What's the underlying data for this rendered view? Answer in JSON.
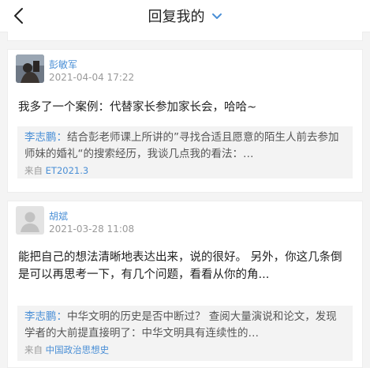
{
  "header": {
    "title": "回复我的",
    "back_icon": "back-arrow-icon",
    "dropdown_icon": "chevron-down-icon"
  },
  "colors": {
    "accent": "#4a8fd6",
    "background": "#f4f4f4"
  },
  "replies": [
    {
      "author": "彭敏军",
      "time": "2021-04-04 17:22",
      "content": "我多了一个案例：代替家长参加家长会，哈哈~",
      "quote_author": "李志鹏：",
      "quote_text": "结合彭老师课上所讲的”寻找合适且愿意的陌生人前去参加师妹的婚礼“的搜索经历，我谈几点我的看法：…",
      "source_prefix": "来自",
      "source_link": "ET2021.3"
    },
    {
      "author": "胡斌",
      "time": "2021-03-28 11:08",
      "content": "能把自己的想法清晰地表达出来，说的很好。 另外，你这几条倒是可以再思考一下，有几个问题，看看从你的角...",
      "quote_author": "李志鹏：",
      "quote_text": "中华文明的历史是否中断过？ 查阅大量演说和论文，发现学者的大前提直接明了：中华文明具有连续性的…",
      "source_prefix": "来自",
      "source_link": "中国政治思想史"
    }
  ]
}
